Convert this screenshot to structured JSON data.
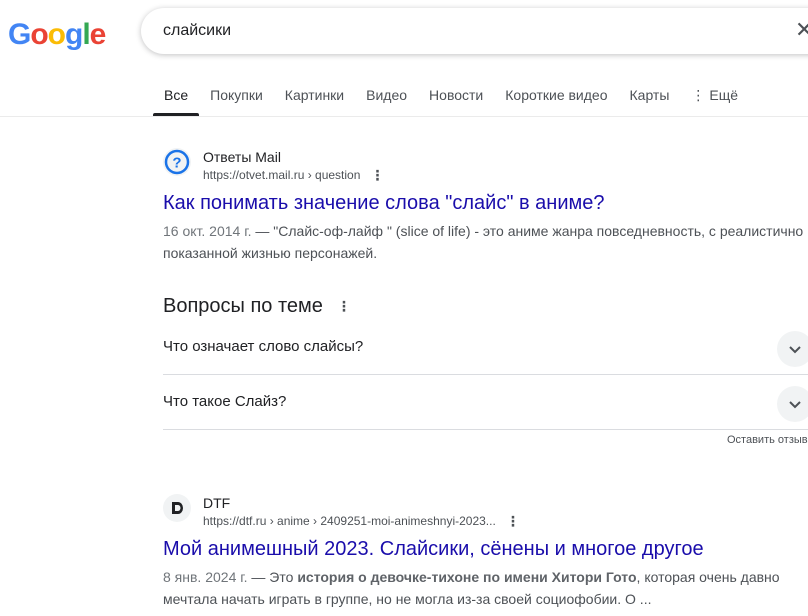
{
  "logo": {
    "letters": [
      "G",
      "o",
      "o",
      "g",
      "l",
      "e"
    ],
    "colors": [
      "#4285F4",
      "#EA4335",
      "#FBBC05",
      "#4285F4",
      "#34A853",
      "#EA4335"
    ]
  },
  "search": {
    "query": "слайсики",
    "clear_icon": "close-icon"
  },
  "tabs": [
    {
      "label": "Все",
      "active": true
    },
    {
      "label": "Покупки"
    },
    {
      "label": "Картинки"
    },
    {
      "label": "Видео"
    },
    {
      "label": "Новости"
    },
    {
      "label": "Короткие видео"
    },
    {
      "label": "Карты"
    },
    {
      "label": "Ещё",
      "icon": "more-vert-icon"
    }
  ],
  "results": [
    {
      "site": "Ответы Mail",
      "url": "https://otvet.mail.ru › question",
      "favicon": "question-icon",
      "title": "Как понимать значение слова \"слайс\" в аниме?",
      "date": "16 окт. 2014 г.",
      "snippet": " — \"Слайс-оф-лайф \" (slice of life) - это аниме жанра повседневность, с реалистично показанной жизнью персонажей."
    },
    {
      "site": "DTF",
      "url": "https://dtf.ru › anime › 2409251-moi-animeshnyi-2023...",
      "favicon": "dtf-logo-icon",
      "title": "Мой анимешный 2023. Слайсики, сёнены и многое другое",
      "date": "8 янв. 2024 г.",
      "snippet_pre": " — Это ",
      "snippet_bold": "история о девочке-тихоне по имени Хитори Гото",
      "snippet_post": ", которая очень давно мечтала начать играть в группе, но не могла из-за своей социофобии. О ..."
    }
  ],
  "paa": {
    "title": "Вопросы по теме",
    "questions": [
      "Что означает слово слайсы?",
      "Что такое Слайз?"
    ],
    "feedback": "Оставить отзыв"
  },
  "colors": {
    "link": "#1a0dab",
    "text": "#202124",
    "muted": "#4d5156"
  }
}
